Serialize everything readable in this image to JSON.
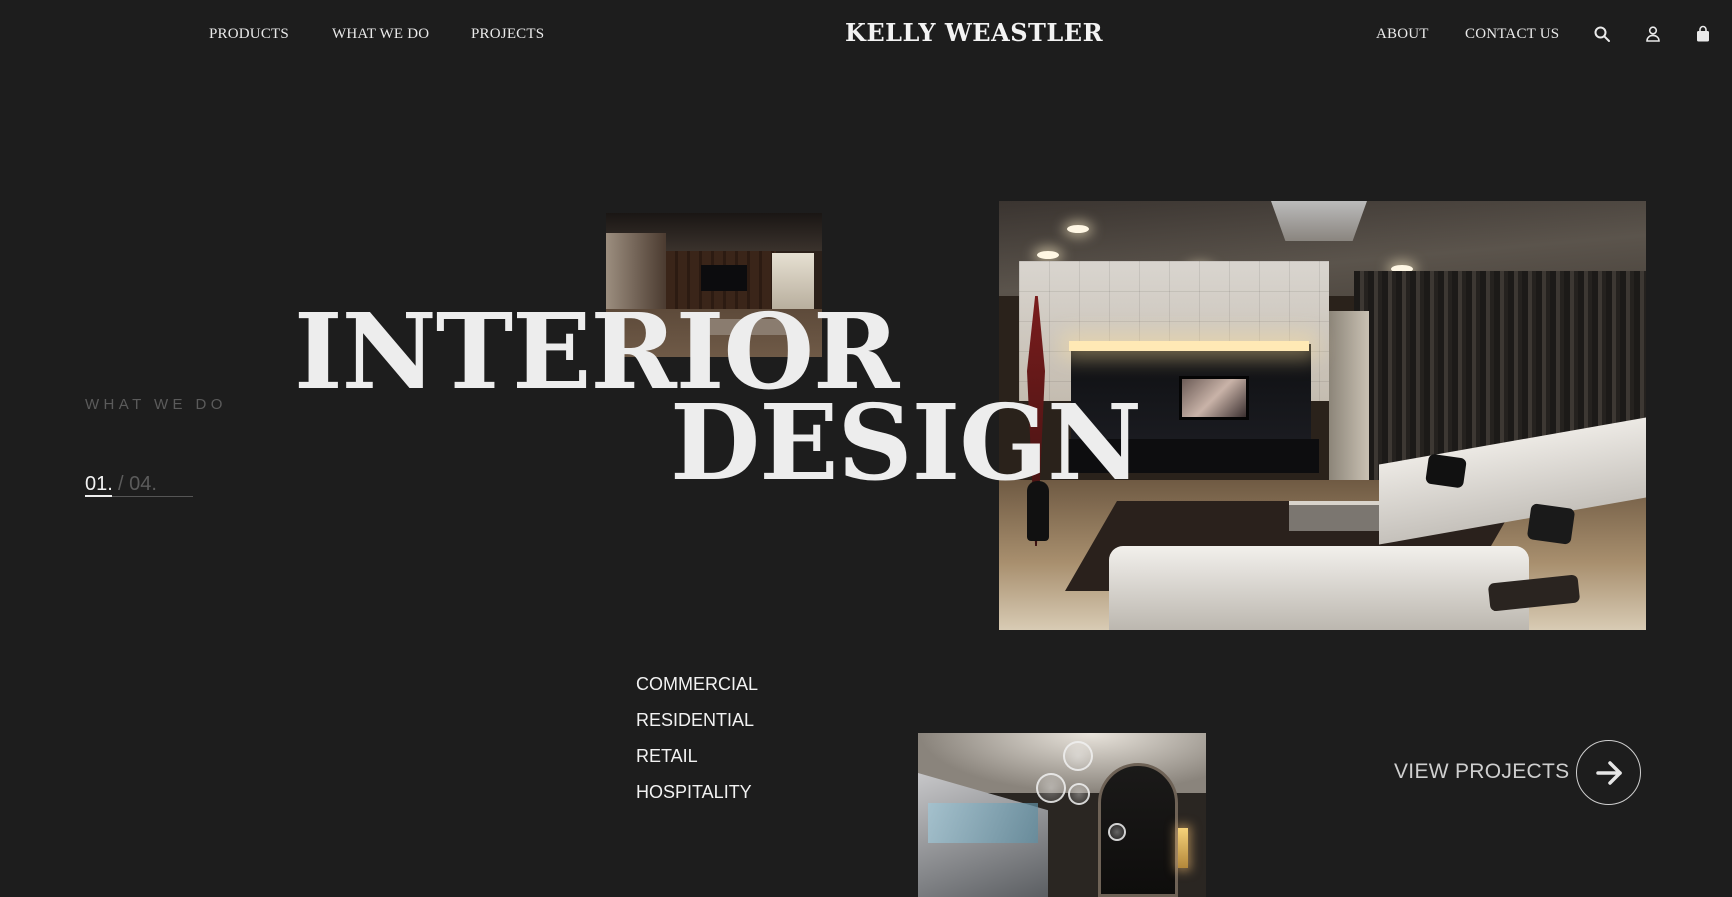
{
  "brand": {
    "name": "KELLY WEASTLER"
  },
  "nav": {
    "left": [
      "PRODUCTS",
      "WHAT WE DO",
      "PROJECTS"
    ],
    "right": [
      "ABOUT",
      "CONTACT US"
    ],
    "icons": [
      "search-icon",
      "account-icon",
      "bag-icon"
    ]
  },
  "hero": {
    "kicker": "WHAT WE DO",
    "pager": {
      "current": "01.",
      "total": "/ 04.",
      "progress": 0.25
    },
    "headline": {
      "line1": "INTERIOR",
      "line2": "DESIGN"
    }
  },
  "categories": [
    "COMMERCIAL",
    "RESIDENTIAL",
    "RETAIL",
    "HOSPITALITY"
  ],
  "cta": {
    "label": "VIEW PROJECTS",
    "icon": "arrow-right-icon"
  },
  "colors": {
    "background": "#1d1d1d",
    "text": "#ededed",
    "muted": "#5b5b5b"
  }
}
